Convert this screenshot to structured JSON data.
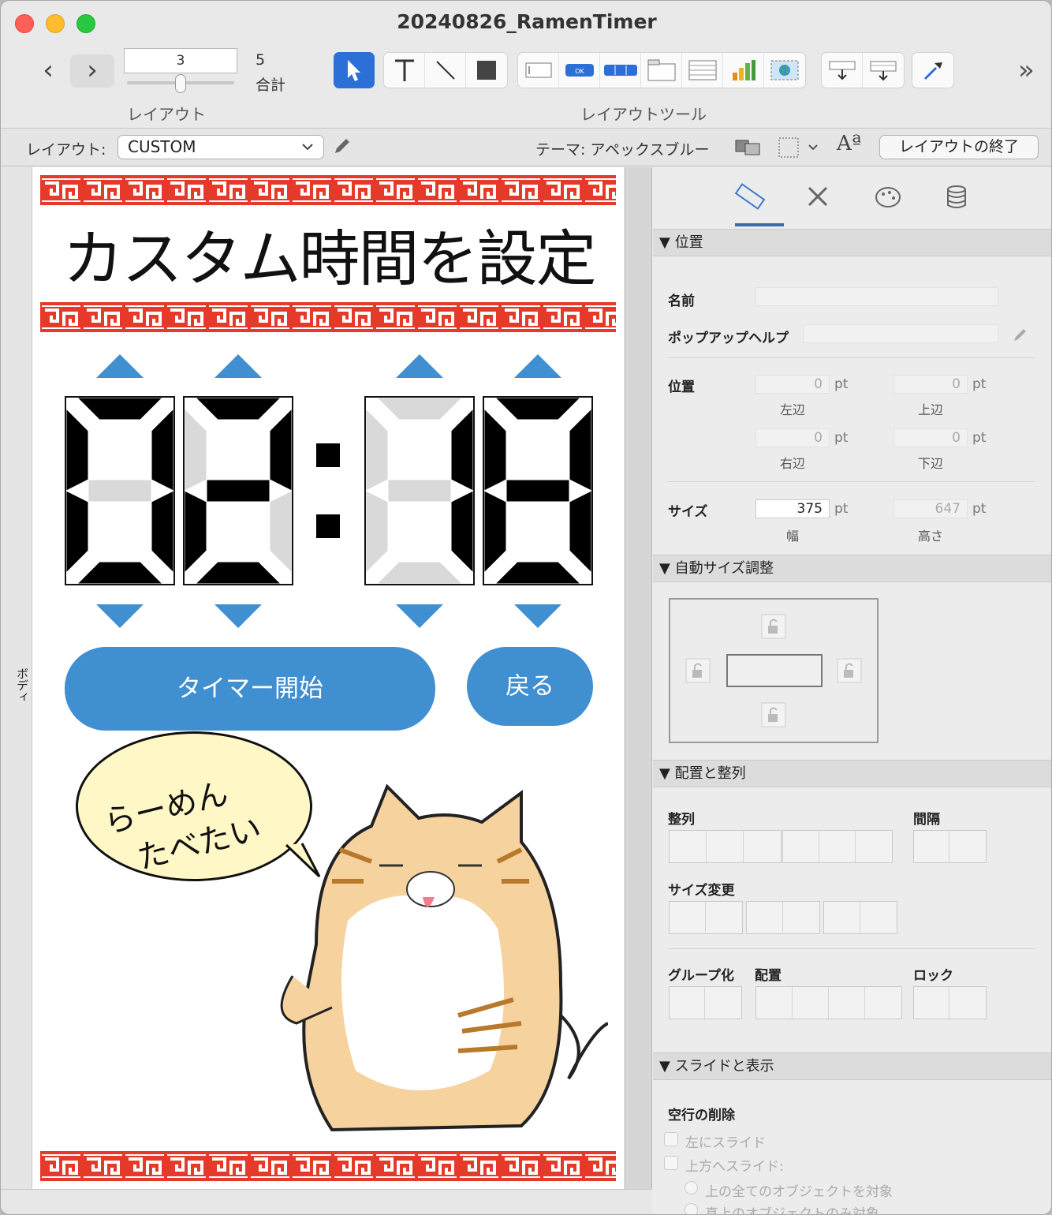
{
  "window": {
    "title": "20240826_RamenTimer"
  },
  "toolbar": {
    "back": "‹",
    "forward": "›",
    "record_number": "3",
    "total_count": "5",
    "total_label": "合計",
    "layout_group_label": "レイアウト",
    "tools_group_label": "レイアウトツール",
    "overflow": "»",
    "tool_icons": [
      "pointer-icon",
      "text-icon",
      "line-icon",
      "shape-icon",
      "field-icon",
      "button-icon",
      "button-bar-icon",
      "tab-control-icon",
      "portal-icon",
      "chart-icon",
      "web-viewer-icon",
      "insert-field-icon",
      "insert-part-icon",
      "format-painter-icon"
    ]
  },
  "layoutbar": {
    "layout_label": "レイアウト:",
    "layout_value": "CUSTOM",
    "theme_label": "テーマ: アペックスブルー",
    "font_icon_text": "Aª",
    "exit_label": "レイアウトの終了"
  },
  "body_part_label": "ボディ",
  "canvas": {
    "headline": "カスタム時間を設定",
    "digits": [
      "0",
      "2",
      "1",
      "8"
    ],
    "start_button": "タイマー開始",
    "back_button": "戻る",
    "bubble_line1": "らーめん",
    "bubble_line2": "たべたい",
    "colors": {
      "accent_blue": "#3f8fd1",
      "pattern_red": "#e53a2a",
      "segment_on": "#000000",
      "segment_off": "#d9d9d9"
    }
  },
  "inspector": {
    "tabs": [
      "ruler-icon",
      "tools-icon",
      "palette-icon",
      "database-icon"
    ],
    "position_section": "位置",
    "name_label": "名前",
    "popup_help_label": "ポップアップヘルプ",
    "position_label": "位置",
    "left_value": "0",
    "top_value": "0",
    "right_value": "0",
    "bottom_value": "0",
    "unit": "pt",
    "left_label": "左辺",
    "top_label": "上辺",
    "right_label": "右辺",
    "bottom_label": "下辺",
    "size_label": "サイズ",
    "width_value": "375",
    "height_value": "647",
    "width_label": "幅",
    "height_label": "高さ",
    "autosize_section": "自動サイズ調整",
    "arrange_section": "配置と整列",
    "align_label": "整列",
    "spacing_label": "間隔",
    "resize_label": "サイズ変更",
    "group_label": "グループ化",
    "arrange_label": "配置",
    "lock_label": "ロック",
    "slide_section": "スライドと表示",
    "remove_blank_label": "空行の削除",
    "slide_left": "左にスライド",
    "slide_up": "上方へスライド:",
    "radio_all": "上の全てのオブジェクトを対象",
    "radio_direct": "真上のオブジェクトのみ対象"
  }
}
